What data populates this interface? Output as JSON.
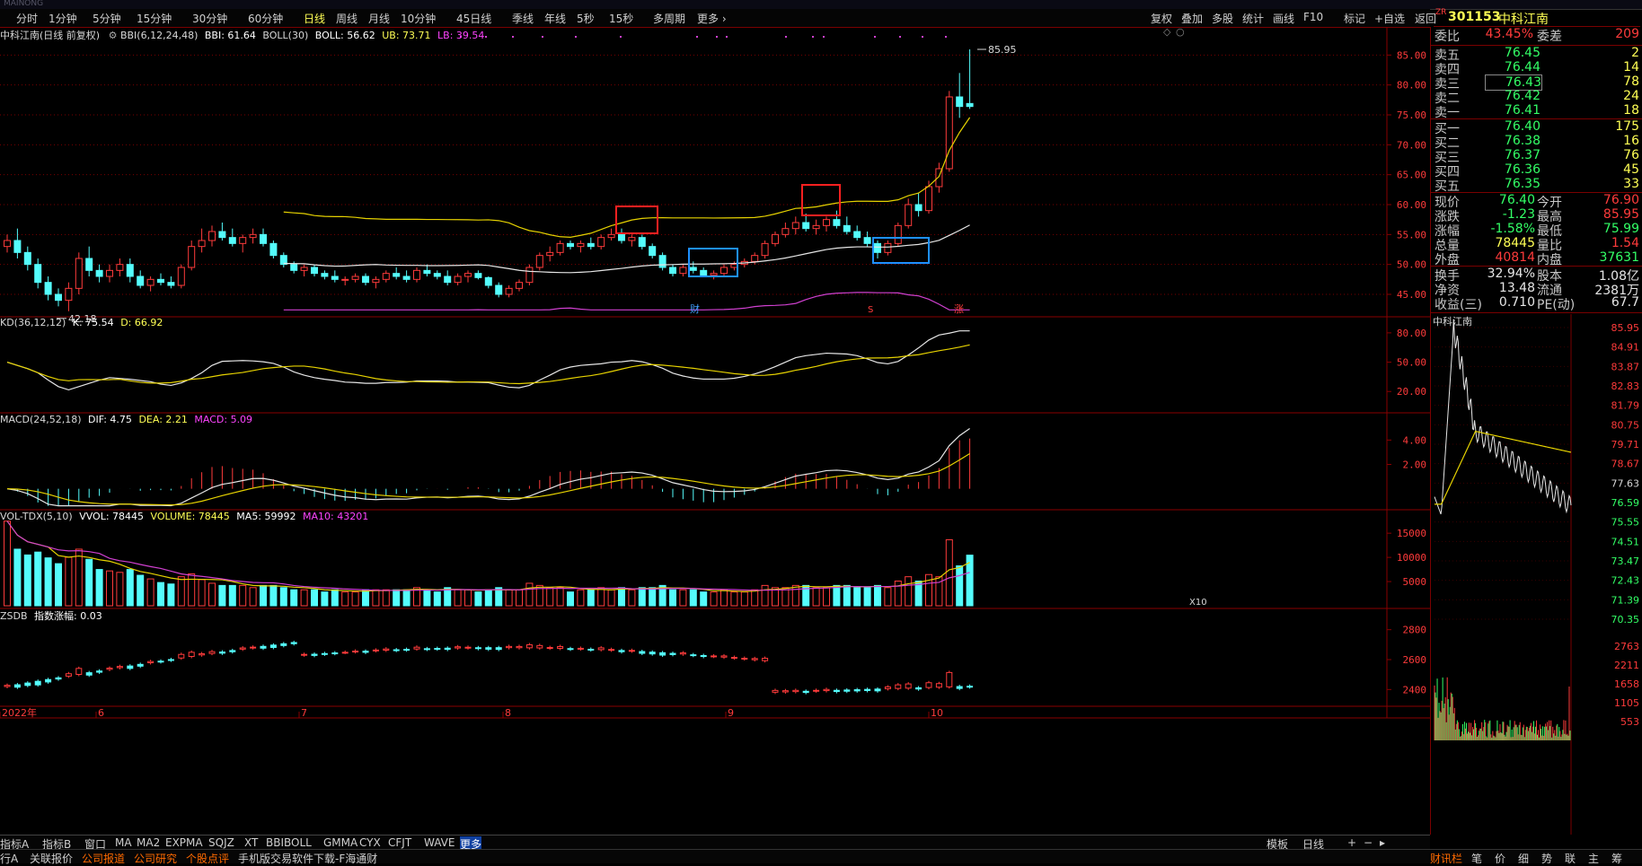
{
  "app": {
    "title_faint": "MAINONG"
  },
  "tabs": [
    "分时",
    "1分钟",
    "5分钟",
    "15分钟",
    "30分钟",
    "60分钟",
    "日线",
    "周线",
    "月线",
    "10分钟",
    "45日线",
    "季线",
    "年线",
    "5秒",
    "15秒",
    "多周期",
    "更多"
  ],
  "active_tab": "日线",
  "right_tabs": [
    "复权",
    "叠加",
    "多股",
    "统计",
    "画线",
    "F10",
    "标记",
    "+自选",
    "返回"
  ],
  "stock": {
    "code": "301153",
    "name": "中科江南",
    "badge": "ZR"
  },
  "legend_main": {
    "name": "中科江南(日线 前复权)",
    "bbi": "BBI(6,12,24,48)",
    "bbi_val": "BBI: 61.64",
    "boll": "BOLL(30)",
    "boll_val": "BOLL: 56.62",
    "ub": "UB: 73.71",
    "lb": "LB: 39.54"
  },
  "legend_kd": {
    "name": "KD(36,12,12)",
    "k": "K: 75.54",
    "d": "D: 66.92"
  },
  "legend_macd": {
    "name": "MACD(24,52,18)",
    "dif": "DIF: 4.75",
    "dea": "DEA: 2.21",
    "macd": "MACD: 5.09"
  },
  "legend_vol": {
    "name": "VOL-TDX(5,10)",
    "vvol": "VVOL: 78445",
    "volume": "VOLUME: 78445",
    "ma5": "MA5: 59992",
    "ma10": "MA10: 43201"
  },
  "legend_zsdb": {
    "name": "ZSDB",
    "chg": "指数涨幅: 0.03"
  },
  "annotations": {
    "high": "85.95",
    "low": "42.18",
    "cai": "财",
    "s": "S",
    "zhang": "涨",
    "x10": "X10"
  },
  "axes": {
    "main": [
      "85.00",
      "80.00",
      "75.00",
      "70.00",
      "65.00",
      "60.00",
      "55.00",
      "50.00",
      "45.00"
    ],
    "kd": [
      "80.00",
      "50.00",
      "20.00"
    ],
    "macd": [
      "4.00",
      "2.00"
    ],
    "vol": [
      "15000",
      "10000",
      "5000"
    ],
    "zsdb": [
      "2800",
      "2600",
      "2400"
    ],
    "dates": [
      "2022年",
      "6",
      "7",
      "8",
      "9",
      "10"
    ]
  },
  "quote": {
    "weibi_label": "委比",
    "weibi": "43.45%",
    "weicha_label": "委差",
    "weicha": "209",
    "asks": [
      {
        "label": "卖五",
        "price": "76.45",
        "vol": "2"
      },
      {
        "label": "卖四",
        "price": "76.44",
        "vol": "14"
      },
      {
        "label": "卖三",
        "price": "76.43",
        "vol": "78"
      },
      {
        "label": "卖二",
        "price": "76.42",
        "vol": "24"
      },
      {
        "label": "卖一",
        "price": "76.41",
        "vol": "18"
      }
    ],
    "bids": [
      {
        "label": "买一",
        "price": "76.40",
        "vol": "175"
      },
      {
        "label": "买二",
        "price": "76.38",
        "vol": "16"
      },
      {
        "label": "买三",
        "price": "76.37",
        "vol": "76"
      },
      {
        "label": "买四",
        "price": "76.36",
        "vol": "45"
      },
      {
        "label": "买五",
        "price": "76.35",
        "vol": "33"
      }
    ],
    "stats": [
      {
        "l1": "现价",
        "v1": "76.40",
        "c1": "green",
        "l2": "今开",
        "v2": "76.90",
        "c2": "red"
      },
      {
        "l1": "涨跌",
        "v1": "-1.23",
        "c1": "green",
        "l2": "最高",
        "v2": "85.95",
        "c2": "red"
      },
      {
        "l1": "涨幅",
        "v1": "-1.58%",
        "c1": "green",
        "l2": "最低",
        "v2": "75.99",
        "c2": "green"
      },
      {
        "l1": "总量",
        "v1": "78445",
        "c1": "yellow",
        "l2": "量比",
        "v2": "1.54",
        "c2": "red"
      },
      {
        "l1": "外盘",
        "v1": "40814",
        "c1": "red",
        "l2": "内盘",
        "v2": "37631",
        "c2": "green"
      }
    ],
    "stats2": [
      {
        "l1": "换手",
        "v1": "32.94%",
        "l2": "股本",
        "v2": "1.08亿"
      },
      {
        "l1": "净资",
        "v1": "13.48",
        "l2": "流通",
        "v2": "2381万"
      },
      {
        "l1": "收益(三)",
        "v1": "0.710",
        "l2": "PE(动)",
        "v2": "67.7"
      }
    ]
  },
  "mini_chart": {
    "title": "中科江南",
    "price_axis": [
      "85.95",
      "84.91",
      "83.87",
      "82.83",
      "81.79",
      "80.75",
      "79.71",
      "78.67",
      "77.63",
      "76.59",
      "75.55",
      "74.51",
      "73.47",
      "72.43",
      "71.39",
      "70.35"
    ],
    "vol_axis": [
      "2763",
      "2211",
      "1658",
      "1105",
      "553"
    ]
  },
  "bottom_tabs": [
    "指标A",
    "指标B",
    "窗口",
    "MA",
    "MA2",
    "EXPMA",
    "SQJZ",
    "XT",
    "BBIBOLL",
    "GMMA",
    "CYX",
    "CFJT",
    "WAVE",
    "更多"
  ],
  "bottom_right": [
    "模板",
    "日线"
  ],
  "status_bar": [
    "行A",
    "关联报价",
    "公司报道",
    "公司研究",
    "个股点评",
    "手机版交易软件下载-F海通财"
  ],
  "status_right": [
    "财讯栏",
    "笔",
    "价",
    "细",
    "势",
    "联",
    "主",
    "筹"
  ],
  "chart_data": {
    "type": "candlestick",
    "title": "中科江南(日线 前复权)",
    "ylim": [
      42,
      87
    ],
    "high_label": 85.95,
    "low_label": 42.18,
    "ohlc": [
      [
        53,
        55,
        52,
        54
      ],
      [
        54,
        56,
        51,
        52
      ],
      [
        52,
        53,
        49,
        50
      ],
      [
        50,
        51,
        46,
        47
      ],
      [
        47,
        48,
        44,
        45
      ],
      [
        45,
        46,
        43,
        44
      ],
      [
        44,
        47,
        42.18,
        46
      ],
      [
        46,
        52,
        45,
        51
      ],
      [
        51,
        53,
        48,
        49
      ],
      [
        49,
        50,
        47,
        48
      ],
      [
        48,
        50,
        47,
        49
      ],
      [
        49,
        51,
        48,
        50
      ],
      [
        50,
        51,
        47,
        48
      ],
      [
        48,
        49,
        46,
        46.5
      ],
      [
        46.5,
        48,
        45.5,
        47.5
      ],
      [
        47.5,
        48.5,
        46.5,
        47
      ],
      [
        47,
        48,
        46,
        46.5
      ],
      [
        46.5,
        50,
        46,
        49.5
      ],
      [
        49.5,
        54,
        49,
        53
      ],
      [
        53,
        56,
        52,
        54
      ],
      [
        54,
        56.5,
        53,
        55.5
      ],
      [
        55.5,
        57,
        54,
        54.5
      ],
      [
        54.5,
        56,
        53,
        53.5
      ],
      [
        53.5,
        55,
        52,
        54.5
      ],
      [
        54.5,
        56,
        53.5,
        55
      ],
      [
        55,
        56,
        53,
        53.5
      ],
      [
        53.5,
        54,
        51,
        51.5
      ],
      [
        51.5,
        52,
        49.5,
        50
      ],
      [
        50,
        50.5,
        48.5,
        49
      ],
      [
        49,
        50,
        48,
        49.5
      ],
      [
        49.5,
        50,
        48,
        48.5
      ],
      [
        48.5,
        49,
        47.5,
        48
      ],
      [
        48,
        49,
        47,
        47.5
      ],
      [
        47.5,
        48,
        46.5,
        47.5
      ],
      [
        47.5,
        48.5,
        47,
        48
      ],
      [
        48,
        48.5,
        46.5,
        47
      ],
      [
        47,
        48,
        46,
        47.5
      ],
      [
        47.5,
        49,
        47,
        48.5
      ],
      [
        48.5,
        49.5,
        47.5,
        48
      ],
      [
        48,
        49,
        47,
        47.5
      ],
      [
        47.5,
        49.5,
        47,
        49
      ],
      [
        49,
        50,
        48,
        48.5
      ],
      [
        48.5,
        49,
        47.5,
        48
      ],
      [
        48,
        49,
        46.5,
        47
      ],
      [
        47,
        48.5,
        46.5,
        48
      ],
      [
        48,
        49,
        47,
        48.5
      ],
      [
        48.5,
        49,
        47.5,
        47.8
      ],
      [
        47.8,
        48,
        46,
        46.5
      ],
      [
        46.5,
        47,
        44.5,
        45
      ],
      [
        45,
        46.5,
        44.5,
        46
      ],
      [
        46,
        47.5,
        45.5,
        47
      ],
      [
        47,
        50,
        46.5,
        49.5
      ],
      [
        49.5,
        52,
        49,
        51.5
      ],
      [
        51.5,
        53,
        50.5,
        52
      ],
      [
        52,
        54,
        51.5,
        53.5
      ],
      [
        53.5,
        54,
        52.5,
        53
      ],
      [
        53,
        54,
        52,
        53.5
      ],
      [
        53.5,
        54.5,
        52.5,
        53
      ],
      [
        53,
        55,
        52.5,
        54.5
      ],
      [
        54.5,
        56,
        54,
        55
      ],
      [
        55,
        56,
        53.5,
        54
      ],
      [
        54,
        55,
        53,
        54.5
      ],
      [
        54.5,
        55,
        52.5,
        53
      ],
      [
        53,
        53.5,
        51,
        51.5
      ],
      [
        51.5,
        52,
        49,
        49.5
      ],
      [
        49.5,
        50,
        48,
        48.5
      ],
      [
        48.5,
        50,
        48,
        49.5
      ],
      [
        49.5,
        50.5,
        48.5,
        49
      ],
      [
        49,
        49.5,
        48,
        48.2
      ],
      [
        48.2,
        49,
        47.5,
        48.5
      ],
      [
        48.5,
        50,
        48,
        49.5
      ],
      [
        49.5,
        50.5,
        49,
        50
      ],
      [
        50,
        51,
        49.5,
        50.5
      ],
      [
        50.5,
        52,
        50,
        51.5
      ],
      [
        51.5,
        54,
        51,
        53.5
      ],
      [
        53.5,
        55.5,
        53,
        55
      ],
      [
        55,
        57,
        54.5,
        56
      ],
      [
        56,
        58,
        55,
        57
      ],
      [
        57,
        58.5,
        55.5,
        56
      ],
      [
        56,
        57.5,
        55,
        56.5
      ],
      [
        56.5,
        58,
        55.5,
        57.5
      ],
      [
        57.5,
        59,
        56,
        56.5
      ],
      [
        56.5,
        58,
        55,
        55.5
      ],
      [
        55.5,
        56.5,
        54,
        54.5
      ],
      [
        54.5,
        55.5,
        53,
        53.5
      ],
      [
        53.5,
        54,
        51,
        52
      ],
      [
        52,
        54,
        51.5,
        53.5
      ],
      [
        53.5,
        57,
        53,
        56.5
      ],
      [
        56.5,
        61,
        56,
        60
      ],
      [
        60,
        62,
        58,
        59
      ],
      [
        59,
        64,
        58.5,
        63
      ],
      [
        63,
        67,
        62,
        66
      ],
      [
        66,
        79,
        65.5,
        78
      ],
      [
        78,
        82,
        74.5,
        76.4
      ],
      [
        76.9,
        85.95,
        75.99,
        76.4
      ]
    ],
    "kd": {
      "k_end": 75.54,
      "d_end": 66.92,
      "ylim": [
        0,
        90
      ]
    },
    "macd": {
      "dif": 4.75,
      "dea": 2.21,
      "macd": 5.09
    },
    "volume": {
      "last": 78445,
      "ma5": 59992,
      "ma10": 43201,
      "ylim": [
        0,
        18000
      ]
    },
    "zsdb": {
      "ylim": [
        2300,
        2900
      ]
    },
    "x_dates": [
      "2022年",
      "6",
      "7",
      "8",
      "9",
      "10"
    ]
  }
}
